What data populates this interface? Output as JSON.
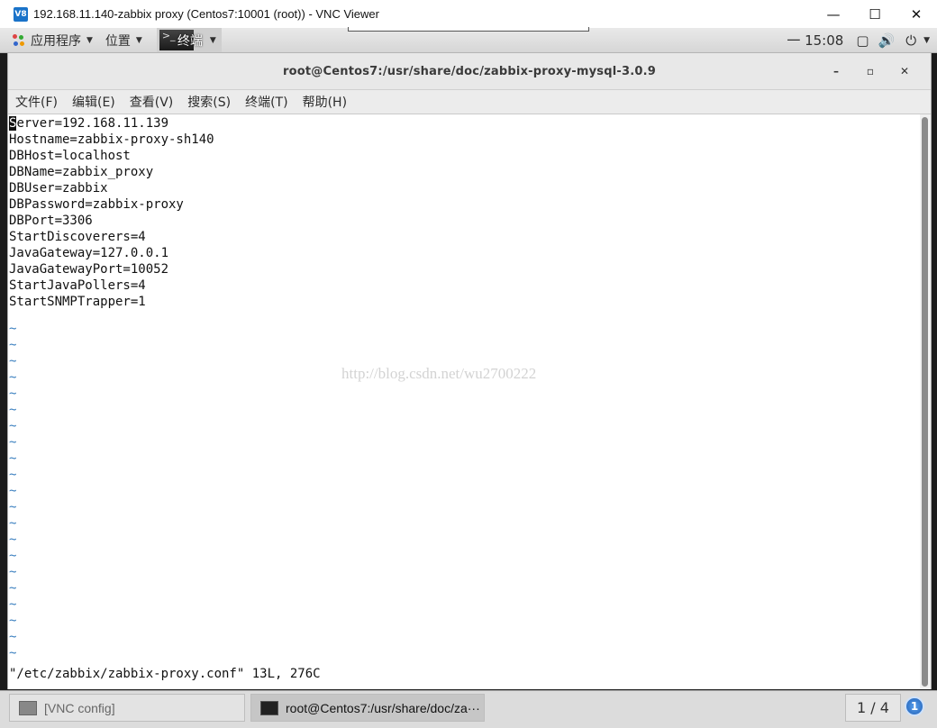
{
  "vnc": {
    "title": "192.168.11.140-zabbix proxy (Centos7:10001 (root)) - VNC Viewer",
    "icon_text": "V8",
    "minimize": "—",
    "maximize": "☐",
    "close": "✕"
  },
  "panel": {
    "applications": "应用程序",
    "places": "位置",
    "terminal": "终端",
    "time": "一 15:08",
    "icons": [
      "window-icon",
      "volume-icon",
      "power-icon"
    ]
  },
  "terminal": {
    "title": "root@Centos7:/usr/share/doc/zabbix-proxy-mysql-3.0.9",
    "minimize": "–",
    "maximize": "▫",
    "close": "✕",
    "menus": [
      "文件(F)",
      "编辑(E)",
      "查看(V)",
      "搜索(S)",
      "终端(T)",
      "帮助(H)"
    ],
    "cursor_char": "S",
    "first_line_rest": "erver=192.168.11.139",
    "lines": [
      "Hostname=zabbix-proxy-sh140",
      "DBHost=localhost",
      "DBName=zabbix_proxy",
      "DBUser=zabbix",
      "DBPassword=zabbix-proxy",
      "DBPort=3306",
      "StartDiscoverers=4",
      "JavaGateway=127.0.0.1",
      "JavaGatewayPort=10052",
      "StartJavaPollers=4",
      "StartSNMPTrapper=1"
    ],
    "tilde": "~",
    "tilde_count": 21,
    "watermark": "http://blog.csdn.net/wu2700222",
    "status": "\"/etc/zabbix/zabbix-proxy.conf\" 13L, 276C"
  },
  "taskbar": {
    "task1": "[VNC config]",
    "task2": "root@Centos7:/usr/share/doc/za···",
    "workspace": "1 / 4",
    "notification_count": "1"
  }
}
